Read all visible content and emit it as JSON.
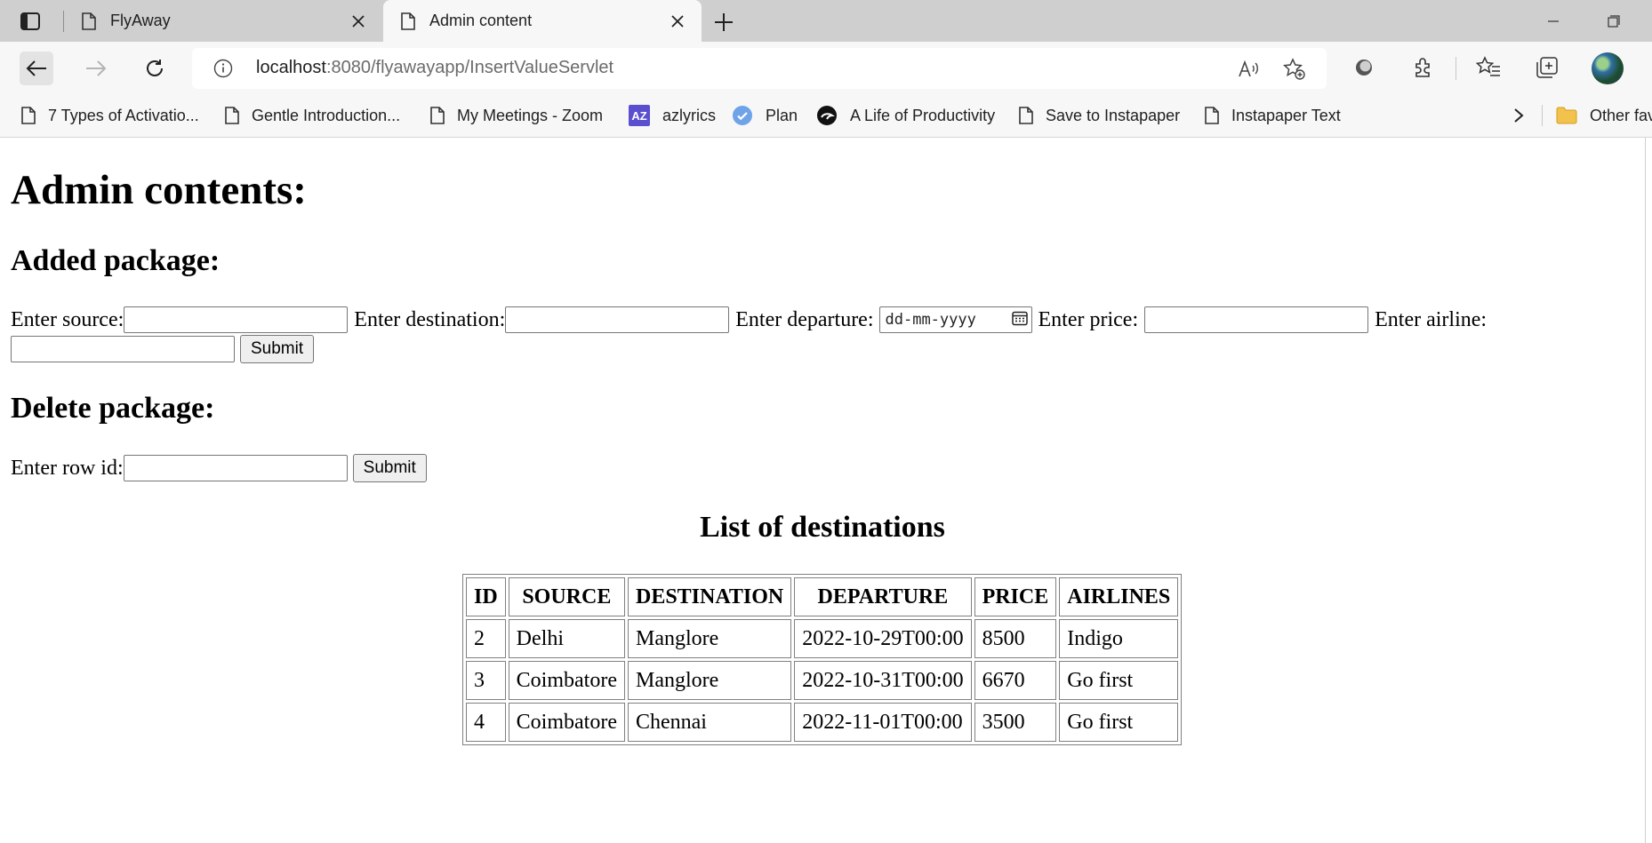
{
  "browser": {
    "tabs": [
      {
        "title": "FlyAway",
        "active": false
      },
      {
        "title": "Admin content",
        "active": true
      }
    ],
    "url_host": "localhost",
    "url_rest": ":8080/flyawayapp/InsertValueServlet",
    "bookmarks": [
      {
        "label": "7 Types of Activatio...",
        "icon": "page-icon"
      },
      {
        "label": "Gentle Introduction...",
        "icon": "page-icon"
      },
      {
        "label": "My Meetings - Zoom",
        "icon": "page-icon"
      },
      {
        "label": "azlyrics",
        "icon": "azlyrics-icon"
      },
      {
        "label": "Plan",
        "icon": "check-badge-icon"
      },
      {
        "label": "A Life of Productivity",
        "icon": "productivity-icon"
      },
      {
        "label": "Save to Instapaper",
        "icon": "page-icon"
      },
      {
        "label": "Instapaper Text",
        "icon": "page-icon"
      },
      {
        "label": "Other fav",
        "icon": "folder-icon"
      }
    ]
  },
  "page": {
    "title": "Admin contents:",
    "add_section": {
      "heading": "Added package:",
      "source_label": "Enter source:",
      "destination_label": "Enter destination:",
      "departure_label": "Enter departure:",
      "departure_placeholder": "dd-mm-yyyy",
      "price_label": "Enter price:",
      "airline_label": "Enter airline:",
      "submit_label": "Submit"
    },
    "delete_section": {
      "heading": "Delete package:",
      "rowid_label": "Enter row id:",
      "submit_label": "Submit"
    },
    "list": {
      "title": "List of destinations",
      "headers": [
        "ID",
        "SOURCE",
        "DESTINATION",
        "DEPARTURE",
        "PRICE",
        "AIRLINES"
      ],
      "rows": [
        [
          "2",
          "Delhi",
          "Manglore",
          "2022-10-29T00:00",
          "8500",
          "Indigo"
        ],
        [
          "3",
          "Coimbatore",
          "Manglore",
          "2022-10-31T00:00",
          "6670",
          "Go first"
        ],
        [
          "4",
          "Coimbatore",
          "Chennai",
          "2022-11-01T00:00",
          "3500",
          "Go first"
        ]
      ]
    }
  }
}
